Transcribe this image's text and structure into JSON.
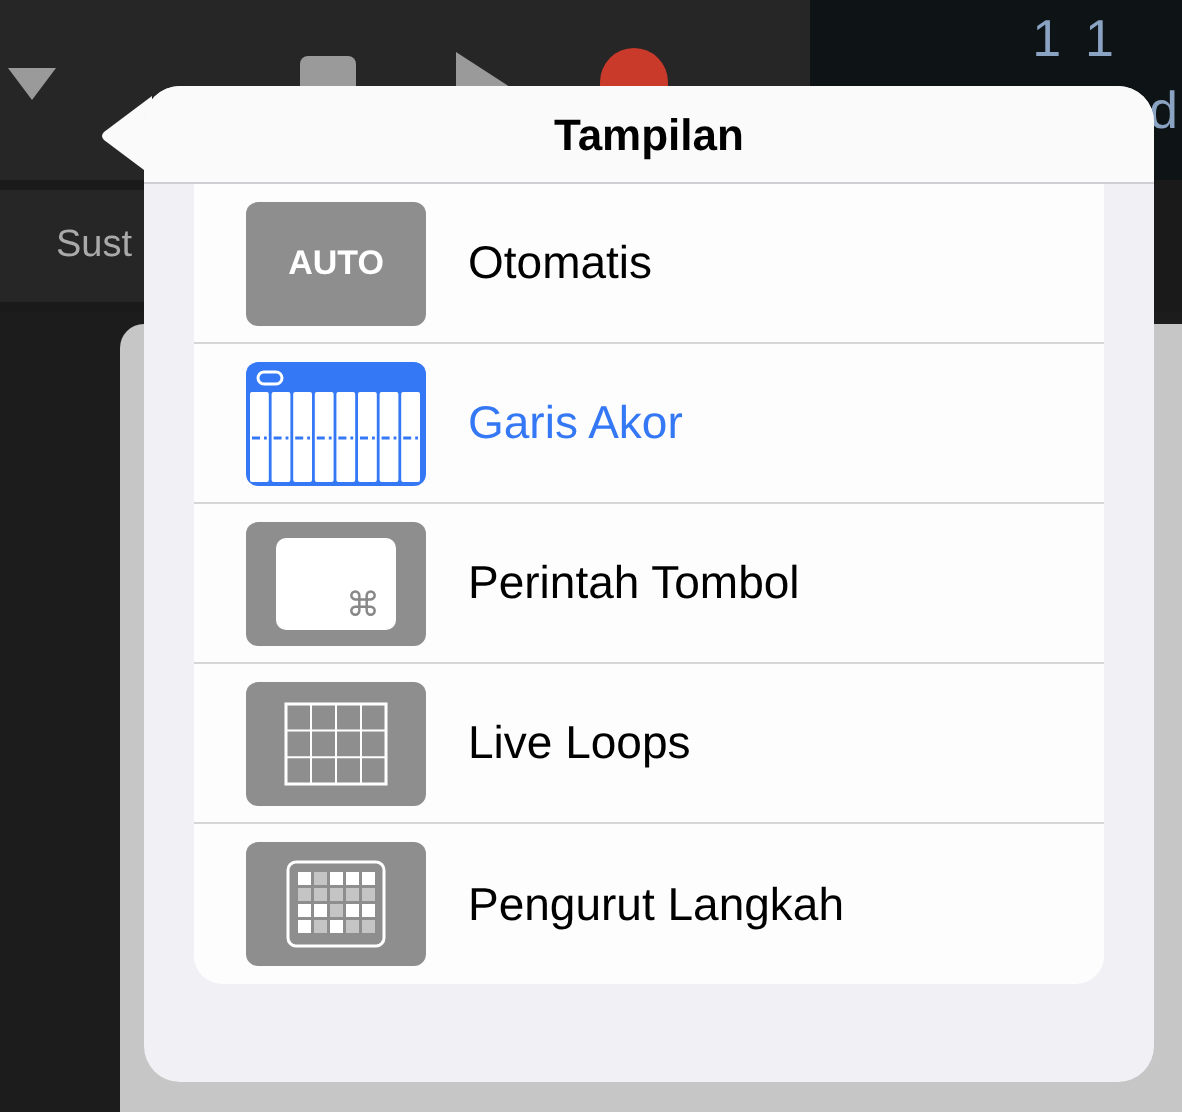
{
  "toolbar": {
    "track_label": "Sust",
    "counter": [
      "1",
      "1"
    ],
    "counter_partial": "d"
  },
  "popover": {
    "title": "Tampilan",
    "items": [
      {
        "kind": "auto",
        "icon_text": "AUTO",
        "label": "Otomatis",
        "selected": false
      },
      {
        "kind": "strips",
        "label": "Garis Akor",
        "selected": true
      },
      {
        "kind": "keys",
        "icon_text": "⌘",
        "label": "Perintah Tombol",
        "selected": false
      },
      {
        "kind": "loops",
        "label": "Live Loops",
        "selected": false
      },
      {
        "kind": "sequencer",
        "label": "Pengurut Langkah",
        "selected": false
      }
    ]
  }
}
